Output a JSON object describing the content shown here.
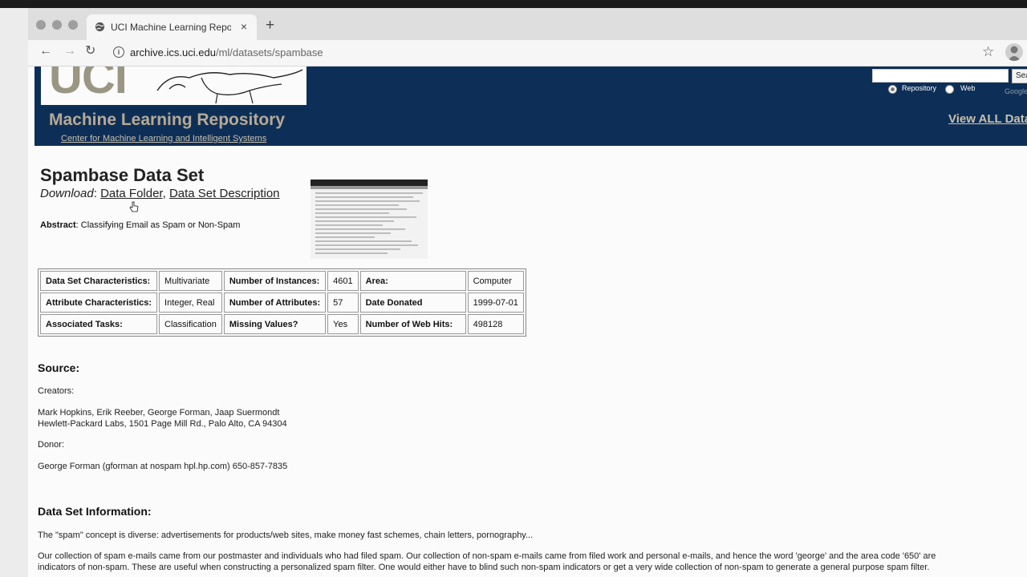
{
  "browser": {
    "tab_title": "UCI Machine Learning Repository: Spambase Data Set",
    "tab_close": "×",
    "new_tab": "+",
    "url_host": "archive.ics.uci.edu",
    "url_path": "/ml/datasets/spambase",
    "icons": {
      "back": "←",
      "forward": "→",
      "reload": "↻",
      "star": "☆",
      "info": "i"
    }
  },
  "header": {
    "logo_text": "UCI",
    "title": "Machine Learning Repository",
    "subtitle_link": "Center for Machine Learning and Intelligent Systems",
    "search_button": "Search",
    "radio_repository": "Repository",
    "radio_web": "Web",
    "search_hint": "Google",
    "view_all": "View ALL Data Sets",
    "colors": {
      "banner": "#0d2f57",
      "title": "#b7a993"
    }
  },
  "dataset": {
    "title": "Spambase Data Set",
    "download_label": "Download",
    "download_links": [
      "Data Folder",
      "Data Set Description"
    ],
    "abstract_label": "Abstract",
    "abstract_text": "Classifying Email as Spam or Non-Spam"
  },
  "characteristics": [
    [
      "Data Set Characteristics:",
      "Multivariate",
      "Number of Instances:",
      "4601",
      "Area:",
      "Computer"
    ],
    [
      "Attribute Characteristics:",
      "Integer, Real",
      "Number of Attributes:",
      "57",
      "Date Donated",
      "1999-07-01"
    ],
    [
      "Associated Tasks:",
      "Classification",
      "Missing Values?",
      "Yes",
      "Number of Web Hits:",
      "498128"
    ]
  ],
  "source": {
    "heading": "Source:",
    "creators_label": "Creators:",
    "creators": "Mark Hopkins, Erik Reeber, George Forman, Jaap Suermondt",
    "address": "Hewlett-Packard Labs, 1501 Page Mill Rd., Palo Alto, CA 94304",
    "donor_label": "Donor:",
    "donor": "George Forman (gforman at nospam hpl.hp.com) 650-857-7835"
  },
  "info": {
    "heading": "Data Set Information:",
    "p1": "The \"spam\" concept is diverse: advertisements for products/web sites, make money fast schemes, chain letters, pornography...",
    "p2a": "Our collection of spam e-mails came from our postmaster and individuals who had filed spam. Our collection of non-spam e-mails came from filed work and personal e-mails, and hence the word 'george' and the area code '650' are",
    "p2b": "indicators of non-spam. These are useful when constructing a personalized spam filter. One would either have to blind such non-spam indicators or get a very wide collection of non-spam to generate a general purpose spam filter."
  }
}
